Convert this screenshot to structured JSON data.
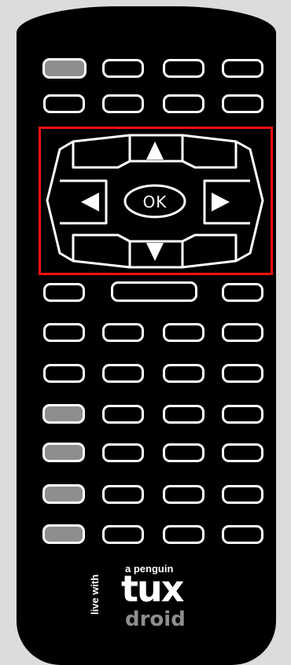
{
  "remote": {
    "colors": {
      "body": "#000000",
      "outline": "#ffffff",
      "gray_key": "#8e8e8e",
      "highlight": "#ff1010",
      "background": "#dcdcdc"
    },
    "dpad": {
      "ok_label": "OK",
      "icons": [
        "up-arrow-icon",
        "down-arrow-icon",
        "left-arrow-icon",
        "right-arrow-icon"
      ],
      "highlighted": true
    },
    "logo": {
      "small_text": "a penguin",
      "vertical_text": "live with",
      "main_text": "tux",
      "sub_text": "droid"
    }
  }
}
